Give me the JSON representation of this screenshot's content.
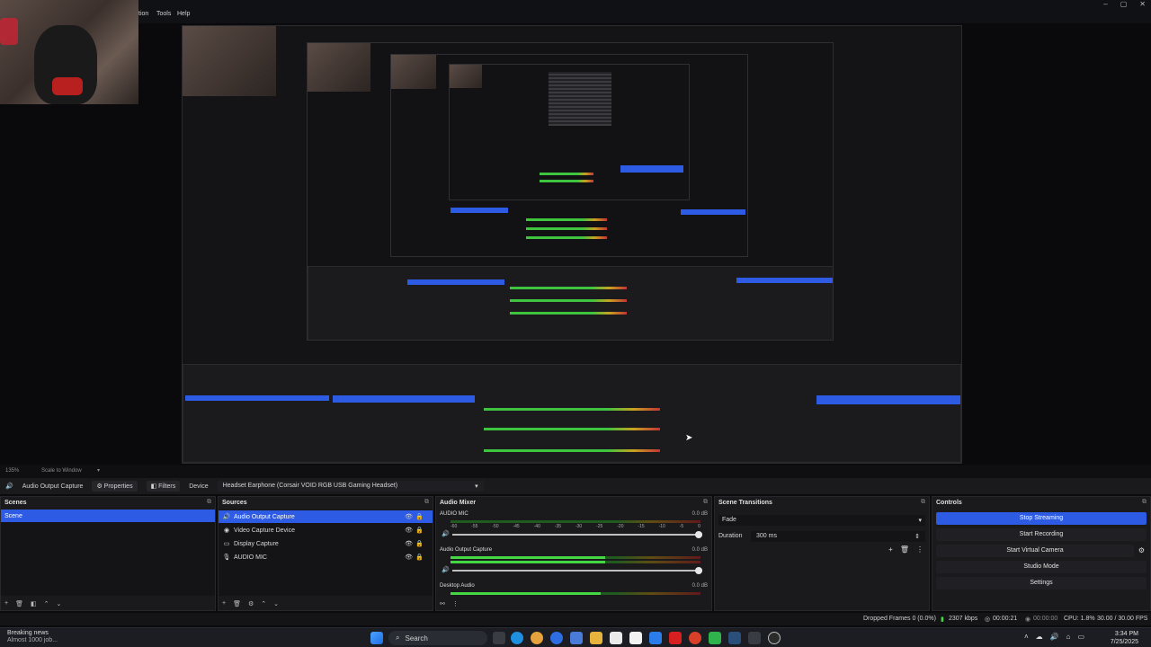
{
  "menu": {
    "items": [
      "tion",
      "Tools",
      "Help"
    ]
  },
  "preview": {
    "zoom_text": "135%",
    "scale_text": "Scale to Window"
  },
  "toolbar": {
    "source_name": "Audio Output Capture",
    "properties_label": "Properties",
    "filters_label": "Filters",
    "device_label": "Device",
    "device_value": "Headset Earphone (Corsair VOID RGB USB Gaming Headset)"
  },
  "scenes": {
    "title": "Scenes",
    "items": [
      "Scene"
    ]
  },
  "sources": {
    "title": "Sources",
    "items": [
      {
        "label": "Audio Output Capture",
        "icon": "speaker-icon"
      },
      {
        "label": "Video Capture Device",
        "icon": "camera-icon"
      },
      {
        "label": "Display Capture",
        "icon": "monitor-icon"
      },
      {
        "label": "AUDIO MIC",
        "icon": "mic-icon"
      }
    ]
  },
  "audio_mixer": {
    "title": "Audio Mixer",
    "channels": [
      {
        "name": "AUDIO MIC",
        "db": "0.0 dB",
        "level": 0.0
      },
      {
        "name": "Audio Output Capture",
        "db": "0.0 dB",
        "level": 0.62
      },
      {
        "name": "Desktop Audio",
        "db": "0.0 dB",
        "level": 0.6
      }
    ],
    "ticks": [
      "-60",
      "-55",
      "-50",
      "-45",
      "-40",
      "-35",
      "-30",
      "-25",
      "-20",
      "-15",
      "-10",
      "-5",
      "0"
    ]
  },
  "transitions": {
    "title": "Scene Transitions",
    "selected": "Fade",
    "duration_label": "Duration",
    "duration_value": "300 ms"
  },
  "controls": {
    "title": "Controls",
    "buttons": [
      "Stop Streaming",
      "Start Recording",
      "Start Virtual Camera",
      "Studio Mode",
      "Settings"
    ]
  },
  "statusbar": {
    "dropped": "Dropped Frames 0 (0.0%)",
    "kbps": "2307 kbps",
    "stream_time": "00:00:21",
    "rec_time": "00:00:00",
    "cpu": "CPU: 1.8%",
    "fps": "30.00 / 30.00 FPS"
  },
  "taskbar": {
    "news_title": "Breaking news",
    "news_sub": "Almost 1000 job...",
    "search_label": "Search",
    "time": "3:34 PM",
    "date": "7/25/2025"
  },
  "colors": {
    "accent": "#2d5be3",
    "meter_green": "#43d843",
    "bg": "#1a1a1d"
  }
}
